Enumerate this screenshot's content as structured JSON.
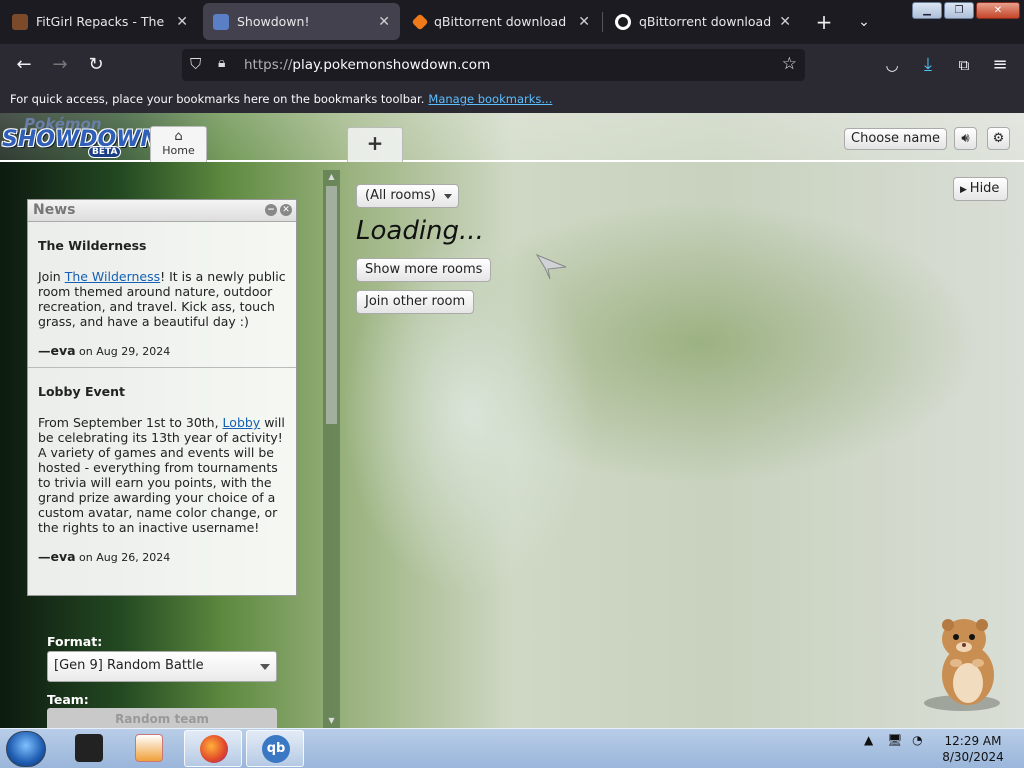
{
  "browser": {
    "tabs": [
      {
        "title": "FitGirl Repacks - The ONLY",
        "icon": "fitgirl-favicon",
        "active": false
      },
      {
        "title": "Showdown!",
        "icon": "showdown-favicon",
        "active": true
      },
      {
        "title": "qBittorrent download | So",
        "icon": "sourceforge-favicon",
        "active": false
      },
      {
        "title": "qBittorrent download lates",
        "icon": "qbittorrent-favicon",
        "active": false
      }
    ],
    "url_scheme": "https://",
    "url_host": "play.pokemonshowdown.com",
    "bookmarks_text": "For quick access, place your bookmarks here on the bookmarks toolbar.",
    "bookmarks_link": "Manage bookmarks..."
  },
  "header": {
    "logo_top": "Pokémon",
    "logo_main": "SHOWDOWN!",
    "logo_badge": "BETA",
    "home_tab_label": "Home",
    "new_tab_label": "+",
    "choose_name_label": "Choose name"
  },
  "news": {
    "title": "News",
    "posts": [
      {
        "heading": "The Wilderness",
        "before_link": "Join ",
        "link": "The Wilderness",
        "after_link": "! It is a newly public room themed around nature, outdoor recreation, and travel. Kick ass, touch grass, and have a beautiful day :)",
        "byline_prefix": "—",
        "author": "eva",
        "date_text": " on Aug 29, 2024"
      },
      {
        "heading": "Lobby Event",
        "before_link": "From September 1st to 30th, ",
        "link": "Lobby",
        "after_link": " will be celebrating its 13th year of activity! A variety of games and events will be hosted - everything from tournaments to trivia will earn you points, with the grand prize awarding your choice of a custom avatar, name color change, or the rights to an inactive username!",
        "byline_prefix": "—",
        "author": "eva",
        "date_text": " on Aug 26, 2024"
      }
    ]
  },
  "battle_form": {
    "format_label": "Format:",
    "format_value": "[Gen 9] Random Battle",
    "team_label": "Team:",
    "team_value": "Random team"
  },
  "rooms": {
    "filter_value": "(All rooms)",
    "loading_text": "Loading...",
    "show_more_label": "Show more rooms",
    "join_other_label": "Join other room",
    "hide_label": "Hide"
  },
  "taskbar": {
    "time": "12:29 AM",
    "date": "8/30/2024"
  },
  "colors": {
    "accent_link": "#1560b4",
    "browser_bg": "#1c1b22"
  }
}
